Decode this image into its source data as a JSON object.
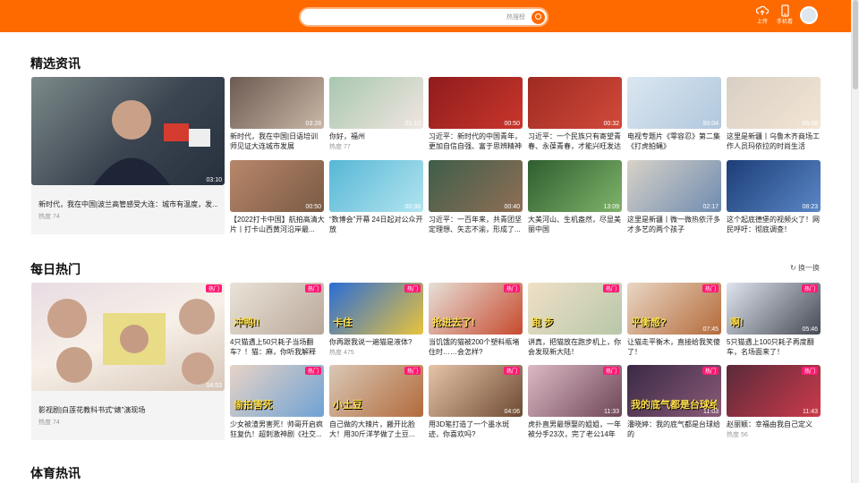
{
  "header": {
    "search_hint": "热搜榜",
    "upload_label": "上传",
    "mobile_label": "手机看"
  },
  "sections": {
    "news": "精选资讯",
    "hot": "每日热门",
    "sports": "体育热讯"
  },
  "refresh_label": "换一换",
  "news_big": {
    "title": "新时代，我在中国|波兰高管感受大连：城市有温度，发...",
    "heat": "热度 74",
    "dur": "03:10"
  },
  "news": [
    {
      "title": "新时代，我在中国|日语培训师见证大连城市发展",
      "heat": "",
      "dur": "03:28"
    },
    {
      "title": "你好，福州",
      "heat": "热度 77",
      "dur": "01:10"
    },
    {
      "title": "习近平：新时代的中国青年，更加自信自强、富于思辨精神",
      "heat": "",
      "dur": "00:50"
    },
    {
      "title": "习近平：一个民族只有寄望青春、永葆青春，才能兴旺发达",
      "heat": "",
      "dur": "00:32"
    },
    {
      "title": "电视专题片《零容忍》第二集《打虎拍蝇》",
      "heat": "",
      "dur": "50:04"
    },
    {
      "title": "这里是新疆丨乌鲁木齐商场工作人员玛依拉的时尚生活",
      "heat": "",
      "dur": "05:08"
    },
    {
      "title": "【2022打卡中国】航拍高清大片丨打卡山西黄河沿岸最...",
      "heat": "",
      "dur": "00:50"
    },
    {
      "title": "“数博会”开幕 24日起对公众开放",
      "heat": "",
      "dur": "00:38"
    },
    {
      "title": "习近平：一百年来，共青团坚定理想、矢志不渝，形成了...",
      "heat": "",
      "dur": "00:40"
    },
    {
      "title": "大美河山、生机盎然，尽显美丽中国",
      "heat": "",
      "dur": "13:09"
    },
    {
      "title": "这里是新疆丨微一微热依汗多才多艺的两个孩子",
      "heat": "",
      "dur": "02:17"
    },
    {
      "title": "这个起底德堡的视频火了！网民呼吁：彻底调查！",
      "heat": "",
      "dur": "08:23"
    }
  ],
  "hot_big": {
    "title": "影视剧|白莲花教科书式“婊”演现场",
    "heat": "热度 74",
    "dur": "04:53",
    "tag": "热门"
  },
  "hot": [
    {
      "title": "4只猫遇上50只耗子当场翻车？！猫：麻，你听我解释",
      "heat": "",
      "dur": "",
      "tag": "热门",
      "cap": "冲鸭!!"
    },
    {
      "title": "你再跟我说一遍猫是液体?",
      "heat": "热度 475",
      "dur": "",
      "tag": "热门",
      "cap": "卡住"
    },
    {
      "title": "当饥饿的猫被200个塑料瓶堵住时……会怎样?",
      "heat": "",
      "dur": "",
      "tag": "热门",
      "cap": "抢进去了!"
    },
    {
      "title": "讲真，把猫放在跑步机上，你会发现新大陆！",
      "heat": "",
      "dur": "",
      "tag": "热门",
      "cap": "跑 步"
    },
    {
      "title": "让猫走平衡木，直接给我笑傻了！",
      "heat": "",
      "dur": "07:45",
      "tag": "热门",
      "cap": "平衡感?"
    },
    {
      "title": "5只猫遇上100只耗子再度翻车，名场面来了！",
      "heat": "",
      "dur": "05:46",
      "tag": "热门",
      "cap": "啊!"
    },
    {
      "title": "少女被渣男害死！帅哥开启疯狂复仇！超刺激神剧《社交...",
      "heat": "",
      "dur": "",
      "tag": "热门",
      "cap": "偷拍害死"
    },
    {
      "title": "自己做的大辣片，搬开比脸大！用30斤洋芋做了土豆...",
      "heat": "",
      "dur": "",
      "tag": "热门",
      "cap": "小土豆"
    },
    {
      "title": "用3D笔打造了一个墨水斑迹，你喜欢吗?",
      "heat": "",
      "dur": "04:06",
      "tag": "热门",
      "cap": ""
    },
    {
      "title": "虎扑直男最想娶的姐姐，一年被分手23次，完了老公14年",
      "heat": "",
      "dur": "11:33",
      "tag": "热门",
      "cap": ""
    },
    {
      "title": "潘晓婷：我的底气都是台球给的",
      "heat": "",
      "dur": "11:03",
      "tag": "热门",
      "cap": "我的底气都是台球给的"
    },
    {
      "title": "赵丽颖：幸福由我自己定义",
      "heat": "热度 56",
      "dur": "11:43",
      "tag": "热门",
      "cap": ""
    }
  ]
}
